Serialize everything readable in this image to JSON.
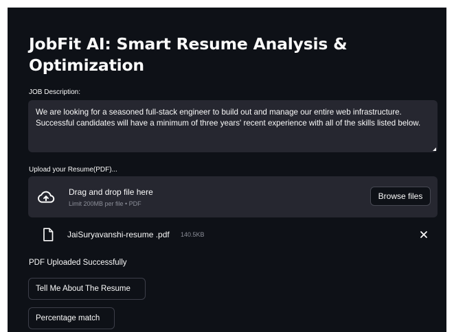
{
  "page": {
    "title": "JobFit AI: Smart Resume Analysis & Optimization"
  },
  "job_description": {
    "label": "JOB Description:",
    "value": "We are looking for a seasoned full-stack engineer to build out and manage our entire web infrastructure. Successful candidates will have a minimum of three years' recent experience with all of the skills listed below."
  },
  "uploader": {
    "label": "Upload your Resume(PDF)...",
    "drop_title": "Drag and drop file here",
    "drop_limit": "Limit 200MB per file • PDF",
    "browse_label": "Browse files",
    "icon": "cloud-upload-icon"
  },
  "uploaded_file": {
    "name": "JaiSuryavanshi-resume .pdf",
    "size": "140.5KB",
    "icon": "file-icon",
    "remove_icon": "close-icon"
  },
  "status": {
    "message": "PDF Uploaded Successfully"
  },
  "actions": {
    "tell_me_label": "Tell Me About The Resume",
    "percentage_label": "Percentage match"
  },
  "colors": {
    "background": "#0e1117",
    "panel": "#262730",
    "text": "#fafafa",
    "muted_text": "#8c8f99",
    "button_border": "#3d3f4a"
  }
}
